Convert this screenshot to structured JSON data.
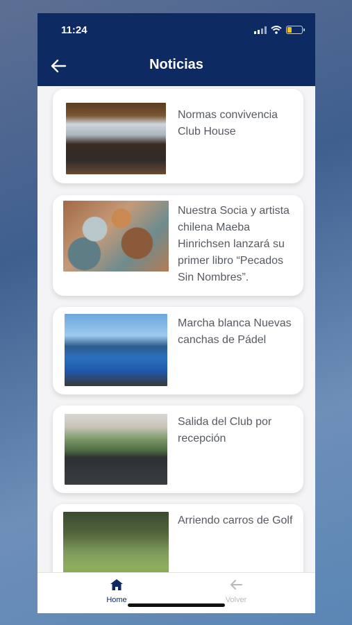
{
  "status_bar": {
    "time": "11:24"
  },
  "header": {
    "title": "Noticias"
  },
  "news": [
    {
      "title": "Normas convivencia Club House"
    },
    {
      "title": "Nuestra Socia y artista chilena Maeba Hinrichsen lanzará su primer libro “Pecados Sin Nombres”."
    },
    {
      "title": "Marcha blanca Nuevas canchas de Pádel"
    },
    {
      "title": "Salida del Club por recepción"
    },
    {
      "title": "Arriendo carros de Golf"
    }
  ],
  "tabbar": {
    "home_label": "Home",
    "back_label": "Volver"
  },
  "colors": {
    "primary": "#0e2a63",
    "inactive": "#b9b9b9"
  }
}
